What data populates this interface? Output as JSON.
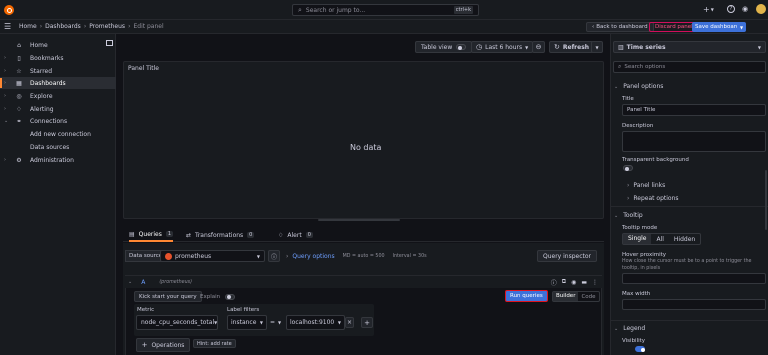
{
  "topbar": {
    "breadcrumb": [
      "Home",
      "Dashboards",
      "Prometheus",
      "Edit panel"
    ],
    "search_placeholder": "Search or jump to...",
    "search_shortcut": "ctrl+k",
    "back_label": "Back to dashboard",
    "discard_label": "Discard panel",
    "save_label": "Save dashboard"
  },
  "sidebar": {
    "items": [
      {
        "label": "Home"
      },
      {
        "label": "Bookmarks"
      },
      {
        "label": "Starred"
      },
      {
        "label": "Dashboards"
      },
      {
        "label": "Explore"
      },
      {
        "label": "Alerting"
      },
      {
        "label": "Connections"
      },
      {
        "label": "Add new connection"
      },
      {
        "label": "Data sources"
      },
      {
        "label": "Administration"
      }
    ]
  },
  "toolbar": {
    "table_view": "Table view",
    "time_range": "Last 6 hours",
    "refresh": "Refresh"
  },
  "panel": {
    "title": "Panel Title",
    "empty": "No data"
  },
  "tabs": [
    {
      "label": "Queries",
      "count": "1"
    },
    {
      "label": "Transformations",
      "count": "0"
    },
    {
      "label": "Alert",
      "count": "0"
    }
  ],
  "query": {
    "datasource_label": "Data source",
    "datasource_value": "prometheus",
    "query_options": "Query options",
    "query_options_meta": "MD = auto = 500",
    "interval": "Interval = 30s",
    "inspector": "Query inspector",
    "ref_id": "A",
    "ref_source": "(prometheus)",
    "kickstart": "Kick start your query",
    "explain": "Explain",
    "run": "Run queries",
    "builder": "Builder",
    "code": "Code",
    "metric_label": "Metric",
    "metric_value": "node_cpu_seconds_total",
    "label_filters": "Label filters",
    "filter_key": "instance",
    "filter_op": "=",
    "filter_value": "localhost:9100",
    "operations": "Operations",
    "hint": "Hint: add rate"
  },
  "options": {
    "viz": "Time series",
    "search_placeholder": "Search options",
    "panel_options": "Panel options",
    "title_label": "Title",
    "title_value": "Panel Title",
    "description_label": "Description",
    "transparent_label": "Transparent background",
    "panel_links": "Panel links",
    "repeat_options": "Repeat options",
    "tooltip": "Tooltip",
    "tooltip_mode": "Tooltip mode",
    "modes": [
      "Single",
      "All",
      "Hidden"
    ],
    "hover_label": "Hover proximity",
    "hover_desc": "How close the cursor must be to a point to trigger the tooltip, in pixels",
    "max_width": "Max width",
    "legend": "Legend",
    "visibility": "Visibility"
  },
  "colors": {
    "accent_blue": "#3d71d9",
    "grafana_orange": "#ff8833",
    "highlight_red": "#e0141f"
  }
}
